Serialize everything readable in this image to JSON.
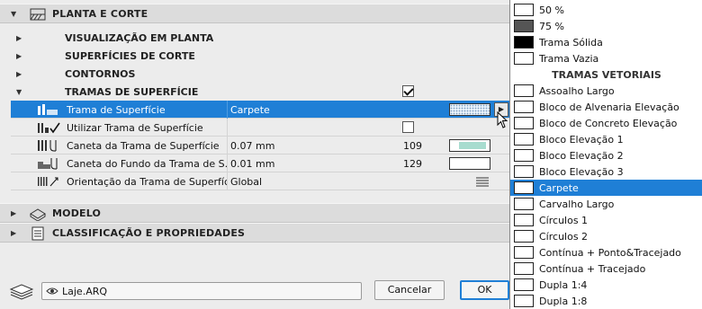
{
  "sections": {
    "plan_section": "PLANTA E CORTE",
    "model": "MODELO",
    "classification": "CLASSIFICAÇÃO E PROPRIEDADES"
  },
  "subgroups": {
    "floor_plan_display": "VISUALIZAÇÃO EM PLANTA",
    "cut_surfaces": "SUPERFÍCIES DE CORTE",
    "outlines": "CONTORNOS",
    "cover_fills": "TRAMAS DE SUPERFÍCIE"
  },
  "properties": {
    "fill": {
      "label": "Trama de Superfície",
      "value": "Carpete"
    },
    "use_fill": {
      "label": "Utilizar Trama de Superfície"
    },
    "fill_pen": {
      "label": "Caneta da Trama de Superfície",
      "value": "0.07 mm",
      "number": "109"
    },
    "bg_pen": {
      "label": "Caneta do Fundo da Trama de S...",
      "value": "0.01 mm",
      "number": "129"
    },
    "orientation": {
      "label": "Orientação da Trama de Superfície",
      "value": "Global"
    }
  },
  "footer": {
    "layer": "Laje.ARQ",
    "cancel": "Cancelar",
    "ok": "OK"
  },
  "popup": {
    "items_top": [
      {
        "label": "50 %",
        "pattern": "p-50"
      },
      {
        "label": "75 %",
        "pattern": "p-75"
      },
      {
        "label": "Trama Sólida",
        "pattern": "p-solid"
      },
      {
        "label": "Trama Vazia",
        "pattern": "p-empty"
      }
    ],
    "vector_header": "TRAMAS VETORIAIS",
    "items_vector": [
      {
        "label": "Assoalho Largo",
        "pattern": "p-floor"
      },
      {
        "label": "Bloco de Alvenaria Elevação",
        "pattern": "p-brick"
      },
      {
        "label": "Bloco de Concreto Elevação",
        "pattern": "p-block"
      },
      {
        "label": "Bloco Elevação 1",
        "pattern": "p-block"
      },
      {
        "label": "Bloco Elevação 2",
        "pattern": "p-brick"
      },
      {
        "label": "Bloco Elevação 3",
        "pattern": "p-block"
      },
      {
        "label": "Carpete",
        "pattern": "p-carpet"
      },
      {
        "label": "Carvalho Largo",
        "pattern": "p-oak"
      },
      {
        "label": "Círculos 1",
        "pattern": "p-circles"
      },
      {
        "label": "Círculos 2",
        "pattern": "p-circles2"
      },
      {
        "label": "Contínua + Ponto&Tracejado",
        "pattern": "p-diag"
      },
      {
        "label": "Contínua + Tracejado",
        "pattern": "p-diag2"
      },
      {
        "label": "Dupla 1:4",
        "pattern": "p-diag3"
      },
      {
        "label": "Dupla 1:8",
        "pattern": "p-diag2"
      }
    ],
    "selected": "Carpete"
  },
  "colors": {
    "accent": "#1f7fd6",
    "pen_swatch": "#a8dccf"
  }
}
